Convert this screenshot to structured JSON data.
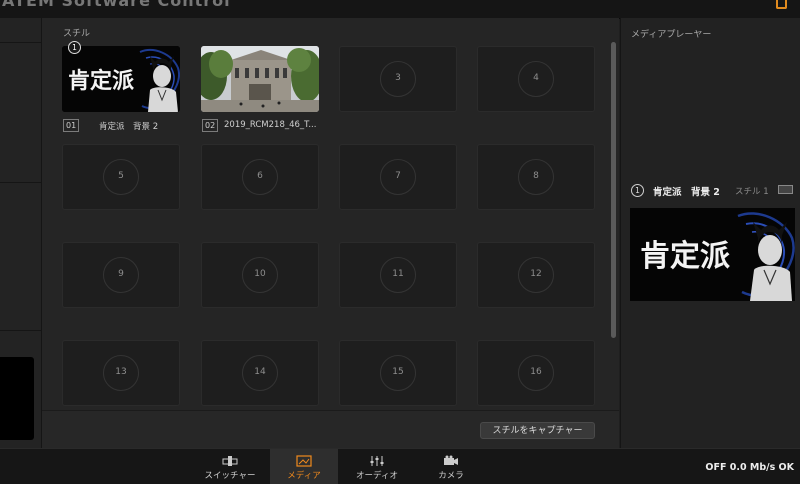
{
  "header": {
    "title": "ATEM Software Control"
  },
  "media_pool": {
    "section_label": "スチル",
    "capture_button": "スチルをキャプチャー",
    "slots": [
      {
        "number": "1",
        "filled": true,
        "caption_index": "01",
        "caption_name": "肯定派　背景 2",
        "art_text": "肯定派"
      },
      {
        "number": "2",
        "filled": true,
        "caption_index": "02",
        "caption_name": "2019_RCM218_46_T..."
      },
      {
        "number": "3"
      },
      {
        "number": "4"
      },
      {
        "number": "5"
      },
      {
        "number": "6"
      },
      {
        "number": "7"
      },
      {
        "number": "8"
      },
      {
        "number": "9"
      },
      {
        "number": "10"
      },
      {
        "number": "11"
      },
      {
        "number": "12"
      },
      {
        "number": "13"
      },
      {
        "number": "14"
      },
      {
        "number": "15"
      },
      {
        "number": "16"
      }
    ],
    "badge": "1"
  },
  "media_player": {
    "title": "メディアプレーヤー",
    "player_number": "1",
    "clip_name": "肯定派　背景 2",
    "clip_type": "スチル 1",
    "art_text": "肯定派"
  },
  "bottom_nav": {
    "tabs": [
      {
        "label": "スイッチャー",
        "icon": "switcher-icon",
        "active": false
      },
      {
        "label": "メディア",
        "icon": "media-icon",
        "active": true
      },
      {
        "label": "オーディオ",
        "icon": "audio-icon",
        "active": false
      },
      {
        "label": "カメラ",
        "icon": "camera-icon",
        "active": false
      }
    ],
    "status": "OFF  0.0 Mb/s  OK"
  },
  "colors": {
    "accent": "#f08a1d",
    "background": "#1f1f1f"
  }
}
